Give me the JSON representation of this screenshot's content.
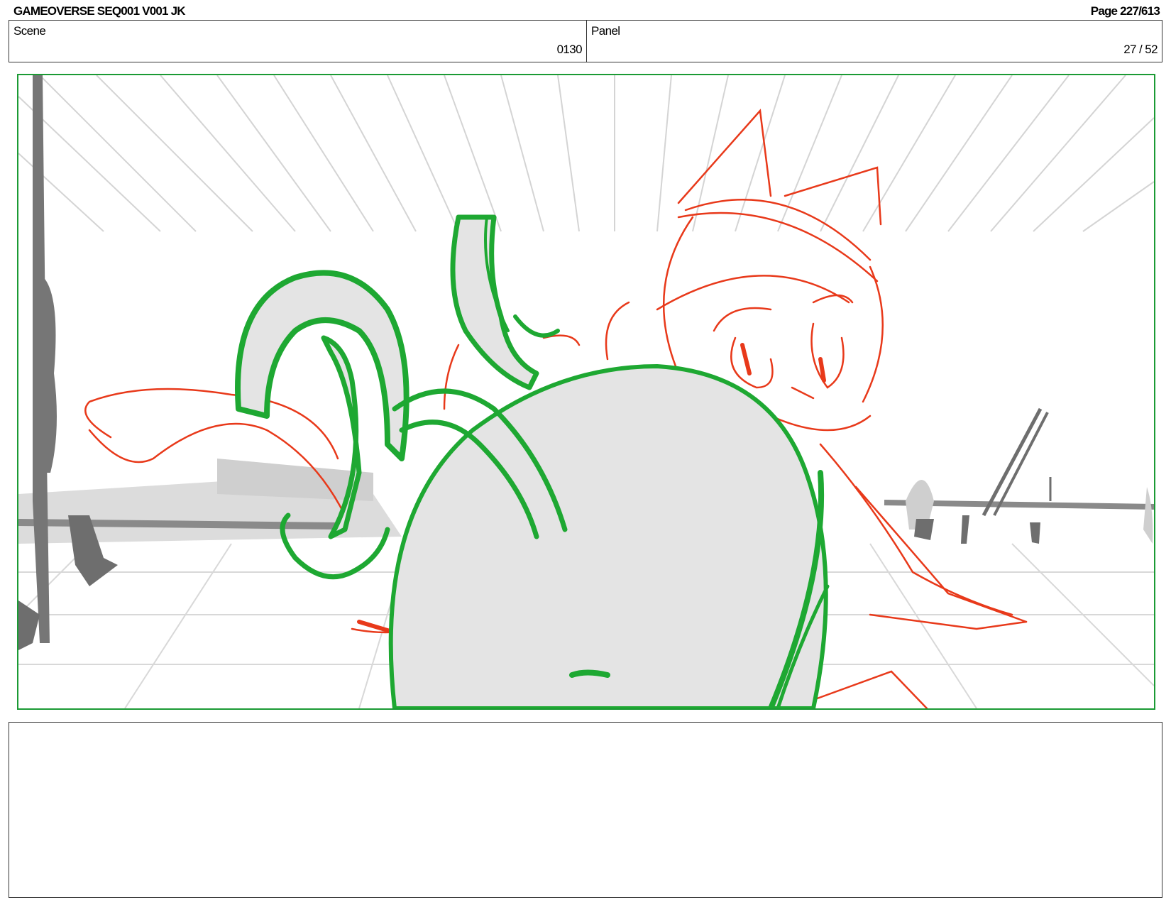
{
  "header": {
    "title": "GAMEOVERSE SEQ001 V001 JK",
    "page": "Page 227/613"
  },
  "info": {
    "scene_label": "Scene",
    "scene_value": "0130",
    "panel_label": "Panel",
    "panel_value": "27 / 52"
  },
  "colors": {
    "frame_border": "#1b9a34",
    "green_lines": "#1ea832",
    "red_lines": "#e8391a",
    "gray_fill": "#e4e4e4",
    "dark_gray": "#6e6e6e",
    "grid": "#d2d2d2"
  },
  "notes": {
    "text": ""
  }
}
